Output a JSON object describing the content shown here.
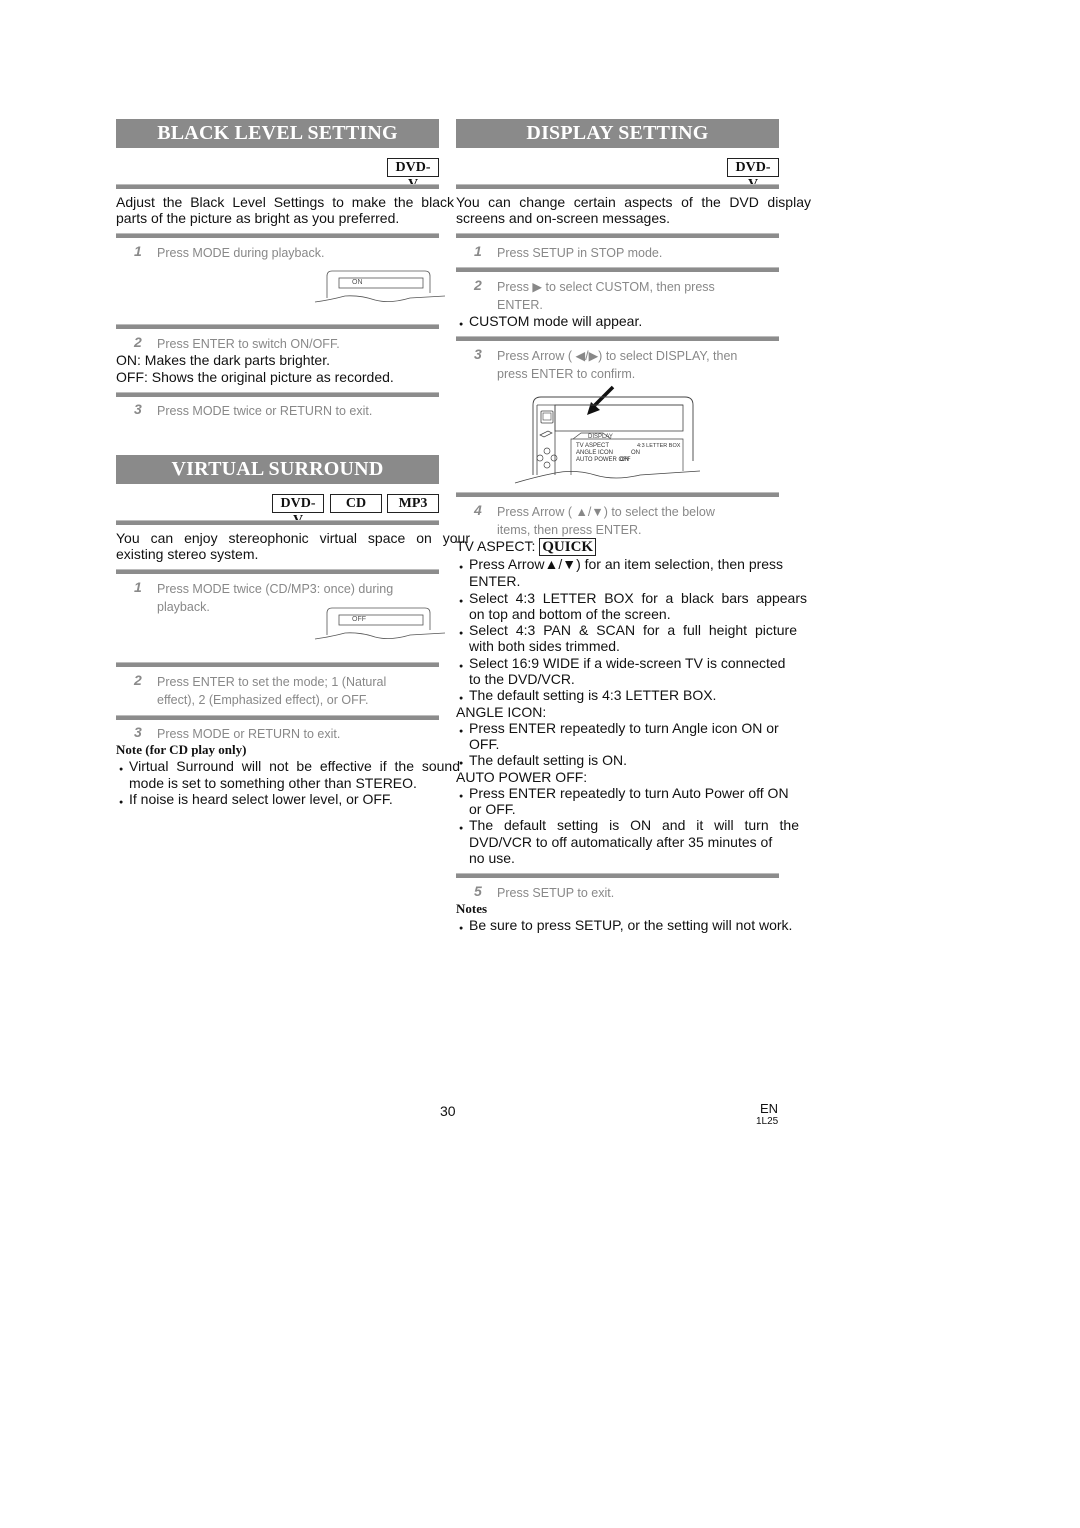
{
  "left": {
    "black_level": {
      "title": "BLACK LEVEL SETTING",
      "badges": [
        "DVD-V"
      ],
      "intro": "Adjust the Black Level Settings to make the black parts of the picture as bright as you preferred.",
      "intro_line1": "Adjust the Black Level Settings to make the black",
      "intro_line2": "parts of the picture as bright as you preferred.",
      "steps": [
        {
          "num": "1",
          "text": "Press MODE during playback."
        },
        {
          "num": "2",
          "text": "Press ENTER to switch ON/OFF."
        },
        {
          "num": "3",
          "text": "Press MODE twice or RETURN to exit."
        }
      ],
      "osd_value": "ON",
      "on_desc": "ON: Makes the dark parts brighter.",
      "off_desc": "OFF: Shows the original picture as recorded."
    },
    "virtual_surround": {
      "title": "VIRTUAL SURROUND",
      "badges": [
        "DVD-V",
        "CD",
        "MP3"
      ],
      "intro_line1": "You can enjoy stereophonic virtual space on your",
      "intro_line2": "existing stereo system.",
      "steps": [
        {
          "num": "1",
          "line1": "Press MODE twice (CD/MP3: once) during",
          "line2": "playback."
        },
        {
          "num": "2",
          "line1": "Press ENTER to set the mode; 1 (Natural",
          "line2": "effect), 2 (Emphasized effect), or OFF."
        },
        {
          "num": "3",
          "line1": "Press MODE or RETURN to exit."
        }
      ],
      "osd_value": "OFF",
      "note_heading": "Note (for CD play only)",
      "notes": [
        {
          "line1": "Virtual Surround will not be effective if the sound",
          "line2": "mode is set to something other than STEREO."
        },
        {
          "line1": "If noise is heard select lower level, or OFF."
        }
      ]
    }
  },
  "right": {
    "display": {
      "title": "DISPLAY SETTING",
      "badges": [
        "DVD-V"
      ],
      "intro_line1": "You can change certain aspects of the DVD display",
      "intro_line2": "screens and on-screen messages.",
      "steps": [
        {
          "num": "1",
          "line1": "Press SETUP in STOP mode."
        },
        {
          "num": "2",
          "line1": "Press ▶ to select CUSTOM, then press",
          "line2": "ENTER."
        },
        {
          "num": "3",
          "line1": "Press Arrow ( ◀/▶) to select DISPLAY, then",
          "line2": "press ENTER to confirm."
        },
        {
          "num": "4",
          "line1": "Press Arrow ( ▲/▼) to select the below",
          "line2": "items, then press ENTER."
        },
        {
          "num": "5",
          "line1": "Press SETUP to exit."
        }
      ],
      "custom_note": "CUSTOM mode will appear.",
      "osd_menu": {
        "tab": "DISPLAY",
        "rows": [
          {
            "label": "TV ASPECT",
            "value": "4:3 LETTER BOX"
          },
          {
            "label": "ANGLE ICON",
            "value": "ON"
          },
          {
            "label": "AUTO POWER OFF",
            "value": "ON"
          }
        ]
      },
      "tv_aspect": {
        "heading": "TV ASPECT:",
        "badge": "QUICK",
        "bullets": [
          {
            "line1": "Press Arrow▲/▼) for an item selection, then press",
            "line2": "ENTER."
          },
          {
            "line1": "Select 4:3 LETTER BOX for a black bars appears",
            "line2": "on top and bottom of the screen."
          },
          {
            "line1": "Select 4:3 PAN & SCAN for a full height picture",
            "line2": "with both sides trimmed."
          },
          {
            "line1": "Select 16:9 WIDE if a wide-screen TV is connected",
            "line2": "to the DVD/VCR."
          },
          {
            "line1": "The default setting is 4:3 LETTER BOX."
          }
        ]
      },
      "angle_icon": {
        "heading": "ANGLE ICON:",
        "bullets": [
          {
            "line1": "Press ENTER repeatedly to turn Angle icon ON or",
            "line2": "OFF."
          },
          {
            "line1": "The default setting is ON."
          }
        ]
      },
      "auto_power_off": {
        "heading": "AUTO POWER OFF:",
        "bullets": [
          {
            "line1": "Press ENTER repeatedly to turn Auto Power off ON",
            "line2": "or OFF."
          },
          {
            "line1": "The default setting is ON and it will turn the",
            "line2": "DVD/VCR to off automatically after 35 minutes of",
            "line3": "no use."
          }
        ]
      },
      "notes_heading": "Notes",
      "notes": [
        "Be sure to press SETUP, or the setting will not work."
      ]
    }
  },
  "footer": {
    "page_number": "30",
    "language": "EN",
    "code": "1L25"
  }
}
